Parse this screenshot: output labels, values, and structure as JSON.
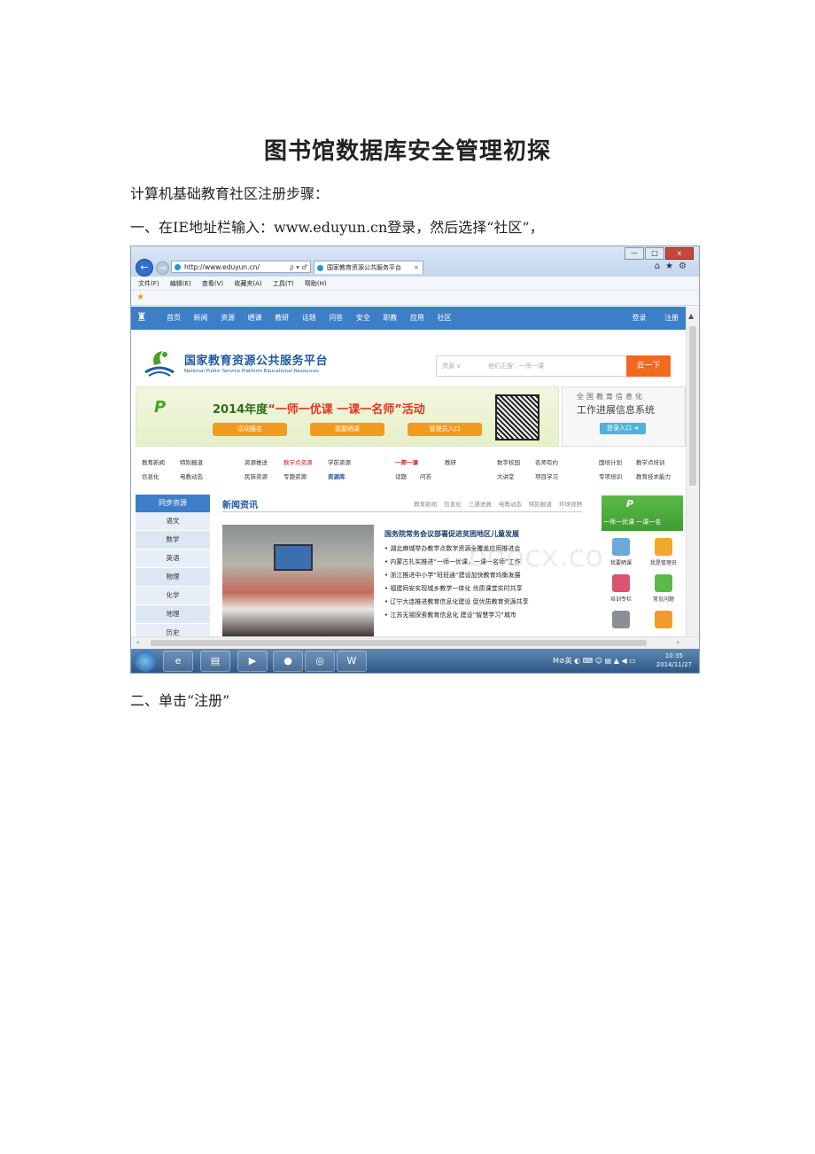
{
  "document": {
    "title": "图书馆数据库安全管理初探",
    "paragraph1": "计算机基础教育社区注册步骤：",
    "paragraph2": "一、在IE地址栏输入：www.eduyun.cn登录，然后选择“社区”，",
    "paragraph3": "二、单击“注册”"
  },
  "browser": {
    "url": "http://www.eduyun.cn/",
    "address_tools": "ρ ▾ ♂",
    "tab_title": "国家教育资源公共服务平台",
    "menu": [
      "文件(F)",
      "编辑(E)",
      "查看(V)",
      "收藏夹(A)",
      "工具(T)",
      "帮助(H)"
    ],
    "window_buttons": [
      "—",
      "□",
      "x"
    ],
    "right_icons": "⌂★⚙"
  },
  "site": {
    "nav": [
      "首页",
      "新闻",
      "资源",
      "晒课",
      "教研",
      "话题",
      "问答",
      "安全",
      "职教",
      "应用",
      "社区"
    ],
    "nav_right": [
      "登录",
      "注册"
    ],
    "brand_cn": "国家教育资源公共服务平台",
    "brand_en": "National Public Service Platform Educational Resources",
    "search_select": "资源 ∨",
    "search_placeholder": "他们正搜：一师一课",
    "search_button": "云一下",
    "banner": {
      "year": "2014年度",
      "activity": "“一师一优课 一课一名师”活动",
      "buttons": [
        "活动报名",
        "我要晒课",
        "管理员入口"
      ]
    },
    "sidebanner": {
      "line1": "全国教育信息化",
      "line2": "工作进展信息系统",
      "enter": "登录入口 ➜"
    },
    "links": {
      "row1": [
        "教育新闻",
        "特别报道",
        "资源推送",
        "教学点资源",
        "学前资源",
        "一师一课",
        "教研",
        "数字校园",
        "名师有约",
        "国培计划",
        "教学点培训"
      ],
      "row2": [
        "信息化",
        "电教动态",
        "民族资源",
        "专题资源",
        "资源库",
        "话题",
        "问答",
        "大讲堂",
        "项目学习",
        "专项培训",
        "教育技术能力"
      ]
    },
    "sidemenu": {
      "head": "同步资源",
      "items": [
        "语文",
        "数学",
        "英语",
        "物理",
        "化学",
        "地理",
        "历史"
      ]
    },
    "news": {
      "heading": "新闻资讯",
      "tabs": [
        "教育新闻",
        "信息化",
        "三通进展",
        "电教动态",
        "特别报道",
        "环球视野"
      ],
      "lead": "国务院常务会议部署促进贫困地区儿童发展",
      "items": [
        "湖北麻城举办教学点数字资源全覆盖应用推进会",
        "内蒙古扎实推进“一师一优课，一课一名师”工作",
        "浙江推进中小学“班班通”建设加快教育均衡发展",
        "福建同安实现城乡教学一体化 优质课堂实时共享",
        "辽宁大连推进教育信息化建设 促优质教育资源共享",
        "江苏无锡探索教育信息化 建设“智慧学习”城市"
      ]
    },
    "rightpanel": {
      "slogan": "一师一优课 一课一名",
      "items": [
        "我要晒课",
        "我是管理员",
        "培训专栏",
        "常见问题"
      ]
    },
    "watermark": "bdocx.com"
  },
  "taskbar": {
    "time": "10:35",
    "date": "2014/11/27",
    "tray_lang": "英"
  },
  "colors": {
    "nav_blue": "#3c7ec8",
    "search_orange": "#f36a1f",
    "banner_green": "#4aa12d"
  }
}
